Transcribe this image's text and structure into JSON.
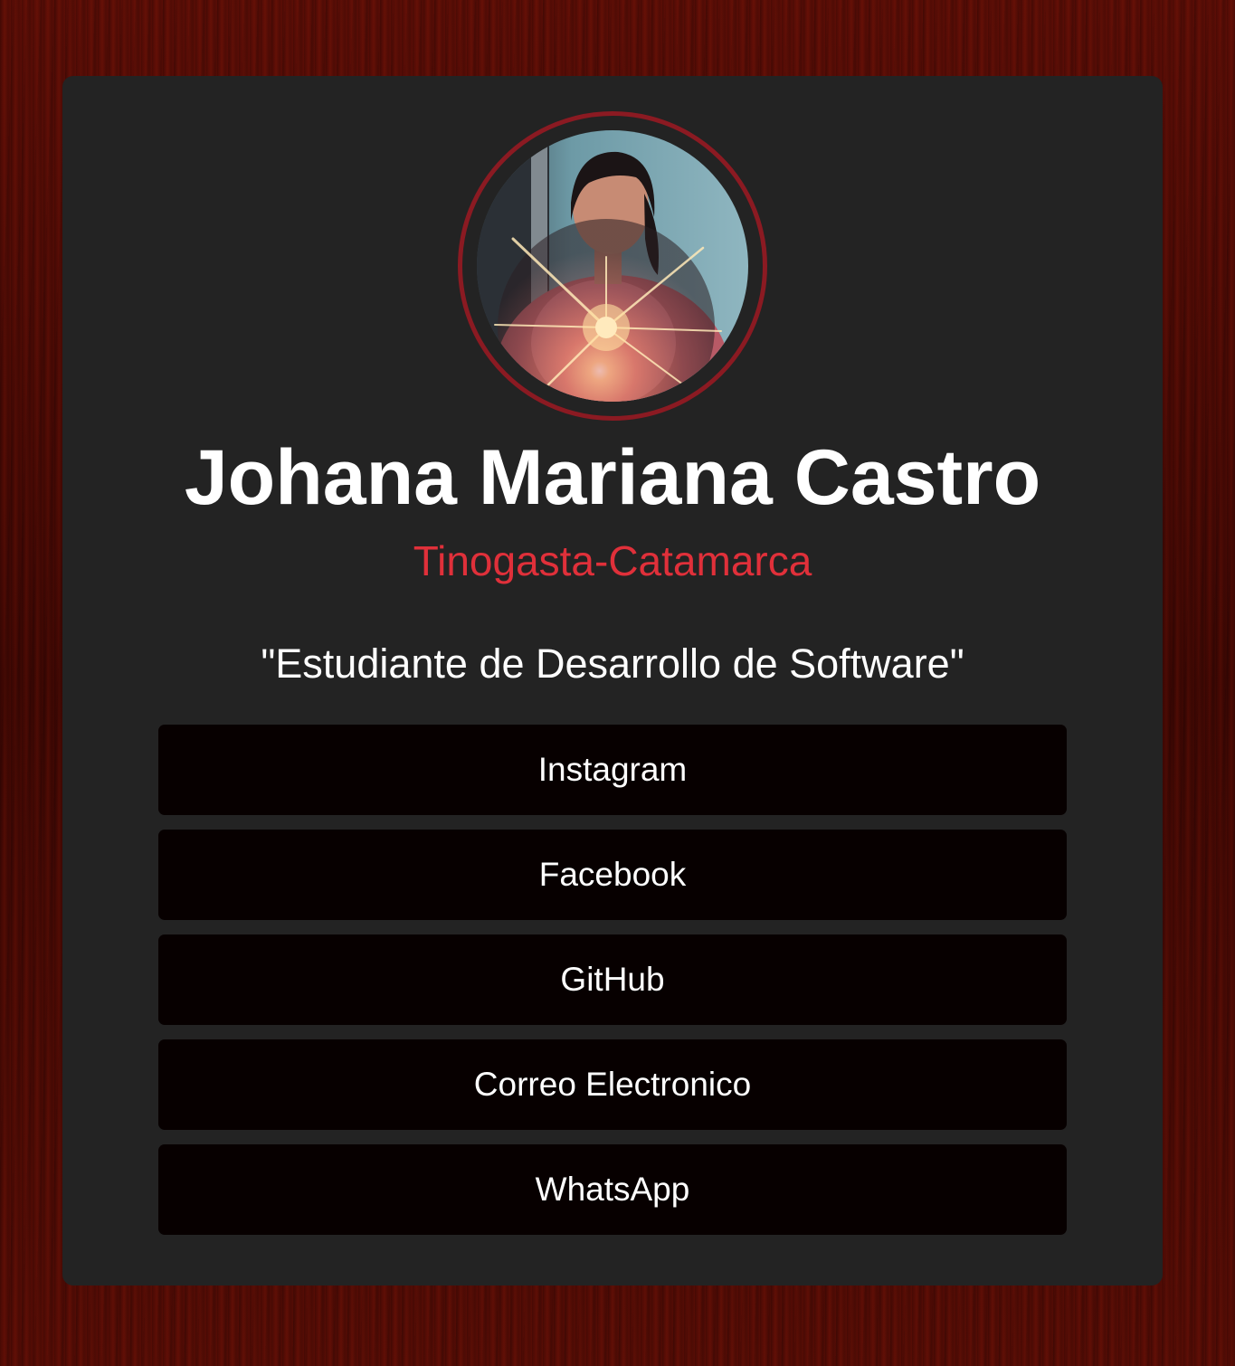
{
  "profile": {
    "name": "Johana Mariana Castro",
    "location": "Tinogasta-Catamarca",
    "tagline": "\"Estudiante de Desarrollo de Software\"",
    "photo_icon": "profile-photo"
  },
  "links": [
    {
      "label": "Instagram"
    },
    {
      "label": "Facebook"
    },
    {
      "label": "GitHub"
    },
    {
      "label": "Correo Electronico"
    },
    {
      "label": "WhatsApp"
    }
  ],
  "colors": {
    "card_background": "#232323",
    "ring": "#8b1a22",
    "location_text": "#e0303a",
    "button_background": "#070000",
    "page_background": "#4a0a05"
  }
}
